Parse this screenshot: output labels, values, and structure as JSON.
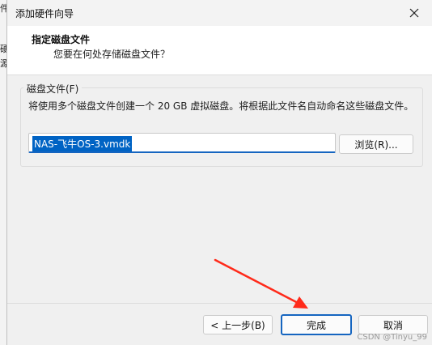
{
  "background": {
    "fragments": [
      "件",
      "硬",
      "源"
    ]
  },
  "window": {
    "title": "添加硬件向导",
    "close_icon": "close-icon"
  },
  "header": {
    "title": "指定磁盘文件",
    "subtitle": "您要在何处存储磁盘文件？"
  },
  "disk_file": {
    "legend": "磁盘文件(F)",
    "description": "将使用多个磁盘文件创建一个 20 GB 虚拟磁盘。将根据此文件名自动命名这些磁盘文件。",
    "value": "NAS-飞牛OS-3.vmdk",
    "browse_label": "浏览(R)..."
  },
  "buttons": {
    "back": "< 上一步(B)",
    "finish": "完成",
    "cancel": "取消"
  },
  "watermark": "CSDN @Tinyu_99",
  "colors": {
    "accent": "#1565c0",
    "selection": "#0063c4",
    "annotation_arrow": "#ff2a1a"
  }
}
